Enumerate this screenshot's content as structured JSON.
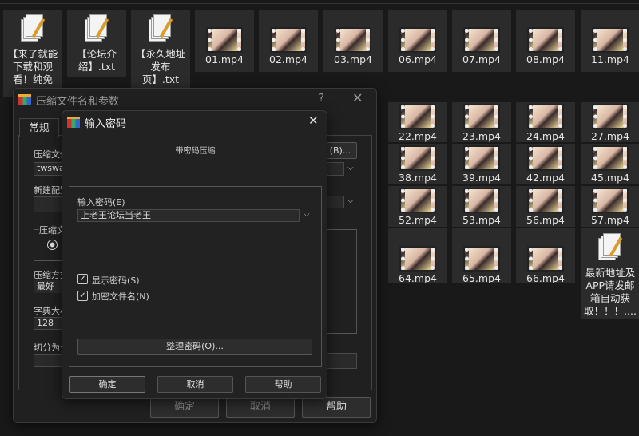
{
  "files": [
    {
      "name": "【来了就能下载和观看！纯免",
      "type": "txt"
    },
    {
      "name": "【论坛介绍】.txt",
      "type": "txt"
    },
    {
      "name": "【永久地址发布页】.txt",
      "type": "txt"
    },
    {
      "name": "01.mp4",
      "type": "mp4"
    },
    {
      "name": "02.mp4",
      "type": "mp4"
    },
    {
      "name": "03.mp4",
      "type": "mp4"
    },
    {
      "name": "06.mp4",
      "type": "mp4"
    },
    {
      "name": "07.mp4",
      "type": "mp4"
    },
    {
      "name": "08.mp4",
      "type": "mp4"
    },
    {
      "name": "11.mp4",
      "type": "mp4"
    },
    {
      "name": "22.mp4",
      "type": "mp4"
    },
    {
      "name": "23.mp4",
      "type": "mp4"
    },
    {
      "name": "24.mp4",
      "type": "mp4"
    },
    {
      "name": "27.mp4",
      "type": "mp4"
    },
    {
      "name": "38.mp4",
      "type": "mp4"
    },
    {
      "name": "39.mp4",
      "type": "mp4"
    },
    {
      "name": "42.mp4",
      "type": "mp4"
    },
    {
      "name": "45.mp4",
      "type": "mp4"
    },
    {
      "name": "52.mp4",
      "type": "mp4"
    },
    {
      "name": "53.mp4",
      "type": "mp4"
    },
    {
      "name": "56.mp4",
      "type": "mp4"
    },
    {
      "name": "57.mp4",
      "type": "mp4"
    },
    {
      "name": "64.mp4",
      "type": "mp4"
    },
    {
      "name": "65.mp4",
      "type": "mp4"
    },
    {
      "name": "66.mp4",
      "type": "mp4"
    },
    {
      "name": "最新地址及APP请发邮箱自动获取！！！....",
      "type": "txt"
    }
  ],
  "archive_dialog": {
    "title": "压缩文件名和参数",
    "help_icon": "?",
    "tab": "常规",
    "archive_name_label": "压缩文件",
    "archive_name_value": "twswag",
    "browse_label": "(B)...",
    "profile_label": "新建配置",
    "format_group_label": "压缩文",
    "method_label": "压缩方式",
    "method_value": "最好",
    "dict_label": "字典大小",
    "dict_value": "128",
    "split_label": "切分为分",
    "ok": "确定",
    "cancel": "取消",
    "help": "帮助"
  },
  "password_dialog": {
    "title": "输入密码",
    "subtitle": "带密码压缩",
    "password_label": "输入密码(E)",
    "password_value": "上老王论坛当老王",
    "show_password": {
      "label": "显示密码(S)",
      "checked": true
    },
    "encrypt_names": {
      "label": "加密文件名(N)",
      "checked": true
    },
    "organize": "整理密码(O)...",
    "ok": "确定",
    "cancel": "取消",
    "help": "帮助"
  }
}
